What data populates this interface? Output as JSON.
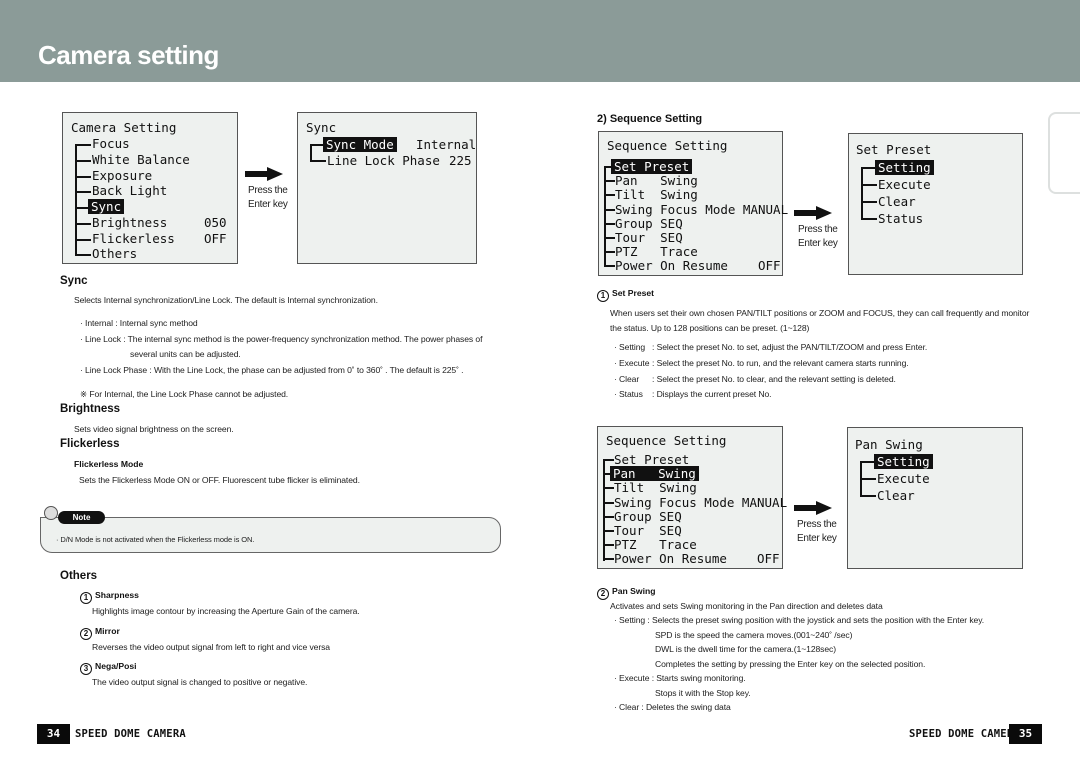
{
  "header": {
    "title": "Camera setting"
  },
  "left": {
    "camera_setting_osd": {
      "title": "Camera Setting",
      "items": [
        {
          "label": "Focus",
          "value": ""
        },
        {
          "label": "White Balance",
          "value": ""
        },
        {
          "label": "Exposure",
          "value": ""
        },
        {
          "label": "Back Light",
          "value": ""
        },
        {
          "label": "Sync",
          "value": "",
          "selected": true
        },
        {
          "label": "Brightness",
          "value": "050"
        },
        {
          "label": "Flickerless",
          "value": "OFF"
        },
        {
          "label": "Others",
          "value": ""
        }
      ]
    },
    "arrow1": {
      "line1": "Press the",
      "line2": "Enter key"
    },
    "sync_osd": {
      "title": "Sync",
      "items": [
        {
          "label": "Sync Mode",
          "value": "Internal",
          "selected": true
        },
        {
          "label": "Line Lock Phase",
          "value": "225"
        }
      ]
    },
    "sync": {
      "heading": "Sync",
      "intro": "Selects Internal synchronization/Line Lock. The default is Internal synchronization.",
      "bullet1": "· Internal : Internal sync method",
      "bullet2a": "· Line Lock : The internal sync method is the power-frequency synchronization method. The power phases of",
      "bullet2b": "several units can be adjusted.",
      "bullet3": "· Line Lock Phase : With the Line Lock, the phase can be adjusted from 0˚ to 360˚ . The default is 225˚ .",
      "remark": "※ For Internal, the Line Lock Phase cannot be adjusted."
    },
    "brightness": {
      "heading": "Brightness",
      "text": "Sets video signal brightness on the screen."
    },
    "flickerless": {
      "heading": "Flickerless",
      "sub": "Flickerless Mode",
      "text": "Sets the Flickerless Mode ON or OFF.  Fluorescent tube flicker is eliminated."
    },
    "note": {
      "badge": "Note",
      "text": "· D/N Mode is not activated when the Flickerless mode is ON."
    },
    "others": {
      "heading": "Others",
      "items": [
        {
          "num": "1",
          "title": "Sharpness",
          "text": "Highlights image contour by increasing the Aperture Gain of the camera."
        },
        {
          "num": "2",
          "title": "Mirror",
          "text": "Reverses the video output signal from left to right and vice versa"
        },
        {
          "num": "3",
          "title": "Nega/Posi",
          "text": "The video output signal is changed to positive or negative."
        }
      ]
    },
    "footer": {
      "page": "34",
      "text": "SPEED DOME CAMERA"
    }
  },
  "right": {
    "heading": "2) Sequence Setting",
    "seq_osd_1": {
      "title": "Sequence Setting",
      "items": [
        "Set Preset",
        "Pan   Swing",
        "Tilt  Swing",
        "Swing Focus Mode MANUAL",
        "Group SEQ",
        "Tour  SEQ",
        "PTZ   Trace",
        "Power On Resume    OFF"
      ],
      "selected_index": 0
    },
    "arrow2": {
      "line1": "Press the",
      "line2": "Enter key"
    },
    "set_preset_osd": {
      "title": "Set Preset",
      "items": [
        "Setting",
        "Execute",
        "Clear",
        "Status"
      ],
      "selected_index": 0
    },
    "set_preset": {
      "num": "1",
      "title": "Set Preset",
      "text1": "When users set their own chosen PAN/TILT positions or ZOOM and FOCUS, they can call frequently and monitor",
      "text2": "the status. Up to 128 positions can be preset. (1~128)",
      "bullets": [
        {
          "term": "· Setting",
          "desc": ": Select the preset No. to set, adjust the PAN/TILT/ZOOM and press Enter."
        },
        {
          "term": "· Execute",
          "desc": ": Select the preset No. to run, and the relevant camera starts running."
        },
        {
          "term": "· Clear",
          "desc": ": Select the preset No. to clear, and the relevant setting is deleted."
        },
        {
          "term": "· Status",
          "desc": ": Displays the current preset No."
        }
      ]
    },
    "seq_osd_2": {
      "title": "Sequence Setting",
      "items": [
        "Set Preset",
        "Pan   Swing",
        "Tilt  Swing",
        "Swing Focus Mode MANUAL",
        "Group SEQ",
        "Tour  SEQ",
        "PTZ   Trace",
        "Power On Resume    OFF"
      ],
      "selected_index": 1
    },
    "arrow3": {
      "line1": "Press the",
      "line2": "Enter key"
    },
    "pan_swing_osd": {
      "title": "Pan Swing",
      "items": [
        "Setting",
        "Execute",
        "Clear"
      ],
      "selected_index": 0
    },
    "pan_swing": {
      "num": "2",
      "title": "Pan Swing",
      "intro": "Activates and sets Swing monitoring in the Pan direction and deletes data",
      "lines": [
        "· Setting  : Selects the preset swing position with the joystick and sets the position with the Enter key.",
        "SPD is the speed the camera moves.(001~240˚ /sec)",
        "DWL is the dwell time for the camera.(1~128sec)",
        "Completes the setting by pressing the Enter key on the selected position.",
        "· Execute : Starts swing monitoring.",
        "Stops it with the Stop key.",
        "· Clear     : Deletes the swing data"
      ]
    },
    "footer": {
      "page": "35",
      "text": "SPEED DOME CAMERA"
    }
  }
}
